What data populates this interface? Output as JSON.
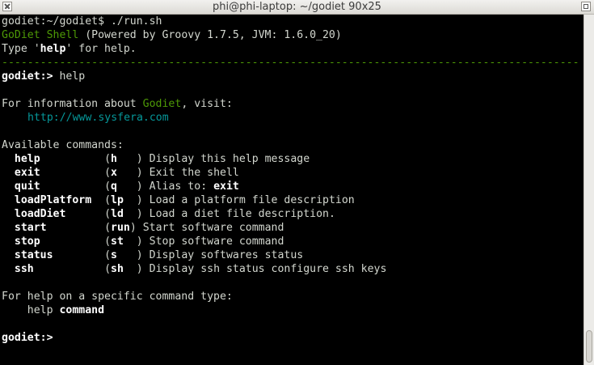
{
  "window": {
    "title": "phi@phi-laptop: ~/godiet 90x25"
  },
  "terminal": {
    "prompt_shell": "godiet:~/godiet$ ",
    "command_run": "./run.sh",
    "banner_name": "GoDiet Shell",
    "banner_rest": " (Powered by Groovy 1.7.5, JVM: 1.6.0_20)",
    "help_pre": "Type '",
    "help_word": "help",
    "help_post": "' for help.",
    "separator": "------------------------------------------------------------------------------------------",
    "prompt": "godiet:>",
    "typed_command": " help",
    "info_pre": "For information about ",
    "info_name": "Godiet",
    "info_post": ", visit:",
    "url": "http://www.sysfera.com",
    "available": "Available commands:",
    "commands": [
      {
        "name": "help",
        "alias": "h   ",
        "desc": " Display this help message",
        "bold": ""
      },
      {
        "name": "exit",
        "alias": "x   ",
        "desc": " Exit the shell",
        "bold": ""
      },
      {
        "name": "quit",
        "alias": "q   ",
        "desc": " Alias to: ",
        "bold": "exit"
      },
      {
        "name": "loadPlatform",
        "alias": "lp  ",
        "desc": " Load a platform file description",
        "bold": ""
      },
      {
        "name": "loadDiet",
        "alias": "ld  ",
        "desc": " Load a diet file description.",
        "bold": ""
      },
      {
        "name": "start",
        "alias": "run",
        "desc": " Start software command",
        "bold": ""
      },
      {
        "name": "stop",
        "alias": "st  ",
        "desc": " Stop software command",
        "bold": ""
      },
      {
        "name": "status",
        "alias": "s   ",
        "desc": " Display softwares status",
        "bold": ""
      },
      {
        "name": "ssh",
        "alias": "sh  ",
        "desc": " Display ssh status configure ssh keys",
        "bold": ""
      }
    ],
    "specific": "For help on a specific command type:",
    "usage_pre": "    help ",
    "usage_arg": "command",
    "final_prompt": "godiet:>"
  }
}
